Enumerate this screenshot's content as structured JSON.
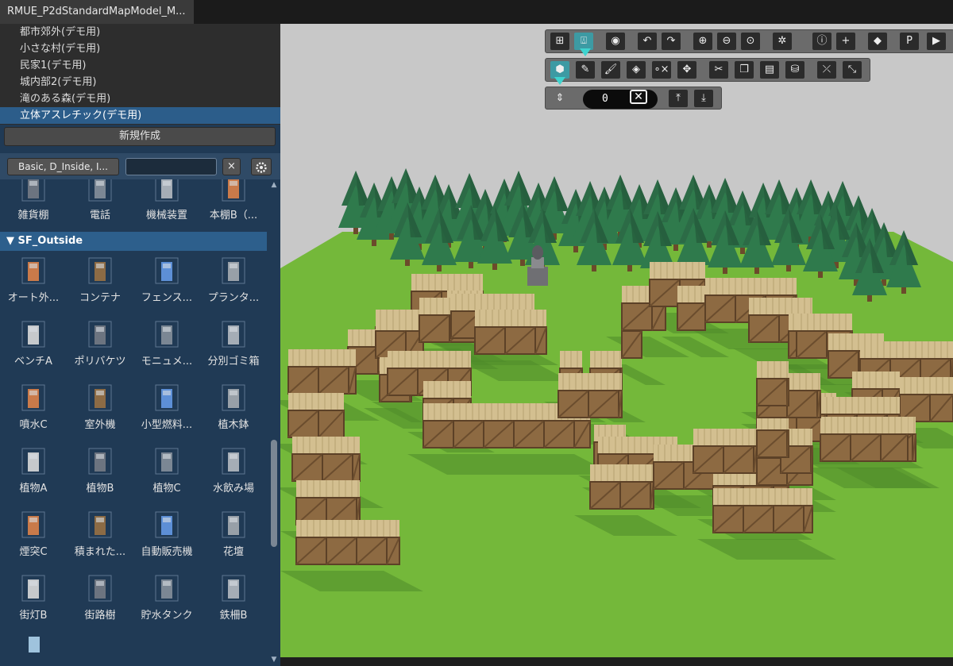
{
  "tab": {
    "title": "RMUE_P2dStandardMapModel_M..."
  },
  "maps": [
    {
      "label": "都市郊外(デモ用)",
      "selected": false
    },
    {
      "label": "小さな村(デモ用)",
      "selected": false
    },
    {
      "label": "民家1(デモ用)",
      "selected": false
    },
    {
      "label": "城内部2(デモ用)",
      "selected": false
    },
    {
      "label": "滝のある森(デモ用)",
      "selected": false
    },
    {
      "label": "立体アスレチック(デモ用)",
      "selected": true
    }
  ],
  "new_button": "新規作成",
  "filter": {
    "label": "Basic, D_Inside, I...",
    "search_value": "",
    "clear": "×"
  },
  "palette": {
    "top_row": [
      "雑貨棚",
      "電話",
      "機械装置",
      "本棚B（..."
    ],
    "category": "SF_Outside",
    "rows": [
      [
        "オート外...",
        "コンテナ",
        "フェンス...",
        "プランタ..."
      ],
      [
        "ベンチA",
        "ポリバケツ",
        "モニュメ...",
        "分別ゴミ箱"
      ],
      [
        "噴水C",
        "室外機",
        "小型燃料...",
        "植木鉢"
      ],
      [
        "植物A",
        "植物B",
        "植物C",
        "水飲み場"
      ],
      [
        "煙突C",
        "積まれた...",
        "自動販売機",
        "花壇"
      ],
      [
        "街灯B",
        "街路樹",
        "貯水タンク",
        "鉄柵B"
      ]
    ]
  },
  "toolbar": {
    "row1_icons": [
      "grid-icon",
      "layer-icon",
      "eye-icon",
      "undo-icon",
      "redo-icon",
      "zoom-in-icon",
      "zoom-out-icon",
      "zoom-fit-icon",
      "gear-icon",
      "info-icon",
      "plus-icon",
      "eraser-tag-icon",
      "p-icon",
      "play-icon"
    ],
    "p_label": "P",
    "plus_label": "+",
    "row2_icons": [
      "cube-icon",
      "pencil-icon",
      "brush-icon",
      "fill-icon",
      "link-icon",
      "move-icon",
      "cut-icon",
      "copy-icon",
      "paste-icon",
      "bucket-icon",
      "unlink-icon",
      "rotate-icon"
    ],
    "height_value": "0",
    "height_clear": "✕"
  },
  "colors": {
    "panel": "#203a55",
    "selected": "#2c5d8a",
    "accent": "#3d9aa3",
    "grass": "#73b838",
    "crate": "#b08a58",
    "tree": "#2f6f47"
  }
}
